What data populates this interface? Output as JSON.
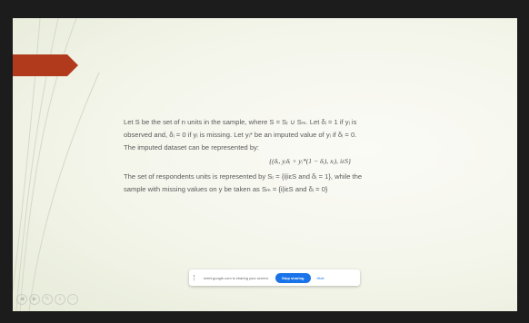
{
  "slide": {
    "para1": {
      "l1": "Let S be the set of n units in the sample, where S = Sᵣ ∪ Sₘ. Let δᵢ = 1 if yᵢ is",
      "l2": "observed and, δᵢ = 0 if yᵢ is missing. Let yᵢ* be an imputed value of yᵢ if δᵢ = 0.",
      "l3": "The imputed dataset can be represented by:"
    },
    "formula": "{(δᵢ, yᵢδᵢ + yᵢ*(1 − δᵢ), xᵢ), iεS}",
    "para2": {
      "l1": "The set of respondents units is represented by Sᵣ = {i|iεS and δᵢ = 1}, while the",
      "l2": "sample with missing values on y be taken as Sₘ = {i|iεS and δᵢ = 0}"
    }
  },
  "share_bar": {
    "message": "meet.google.com is sharing your screen.",
    "stop_label": "Stop sharing",
    "hide_label": "Hide"
  },
  "controls": {
    "icons": [
      "◀",
      "▶",
      "✎",
      "⌕",
      "⋯"
    ]
  },
  "colors": {
    "arrow": "#b23a1c",
    "stop_button": "#1a73e8",
    "slide_bg": "#f3f5ea"
  }
}
